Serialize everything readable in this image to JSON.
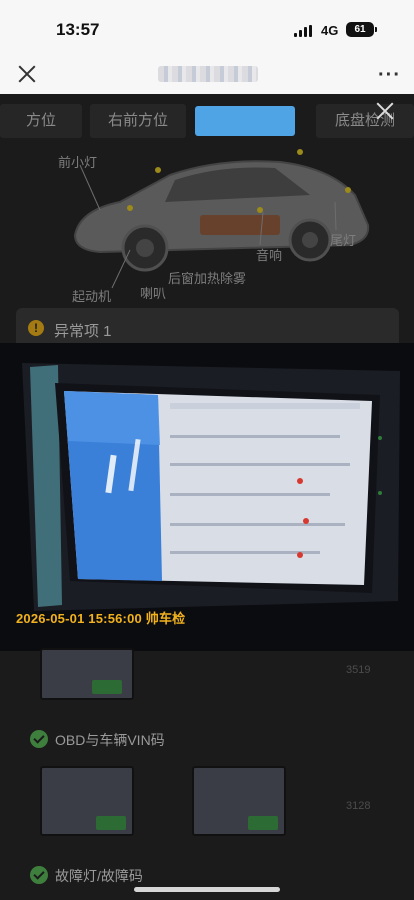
{
  "status_bar": {
    "time": "13:57",
    "network": "4G",
    "battery": "61"
  },
  "tabs": [
    {
      "label": "方位",
      "active": false
    },
    {
      "label": "右前方位",
      "active": false
    },
    {
      "label": "",
      "active": true
    },
    {
      "label": "底盘检测",
      "active": false
    }
  ],
  "car_labels": {
    "front_small_light": "前小灯",
    "sound": "音响",
    "tail_light": "尾灯",
    "rear_defog": "后窗加热除雾",
    "starter": "起动机",
    "horn": "喇叭"
  },
  "abnormal": {
    "title": "异常项 1",
    "icon": "warning-icon"
  },
  "photo": {
    "timestamp": "2026-05-01 15:56:00 帅车检"
  },
  "list": {
    "item_obd": "OBD与车辆VIN码",
    "item_fault": "故障灯/故障码",
    "time_1": "3519",
    "time_2": "3128"
  },
  "colors": {
    "accent": "#4fa4e6",
    "timestamp": "#f2b21e",
    "check": "#3f7f3e"
  }
}
